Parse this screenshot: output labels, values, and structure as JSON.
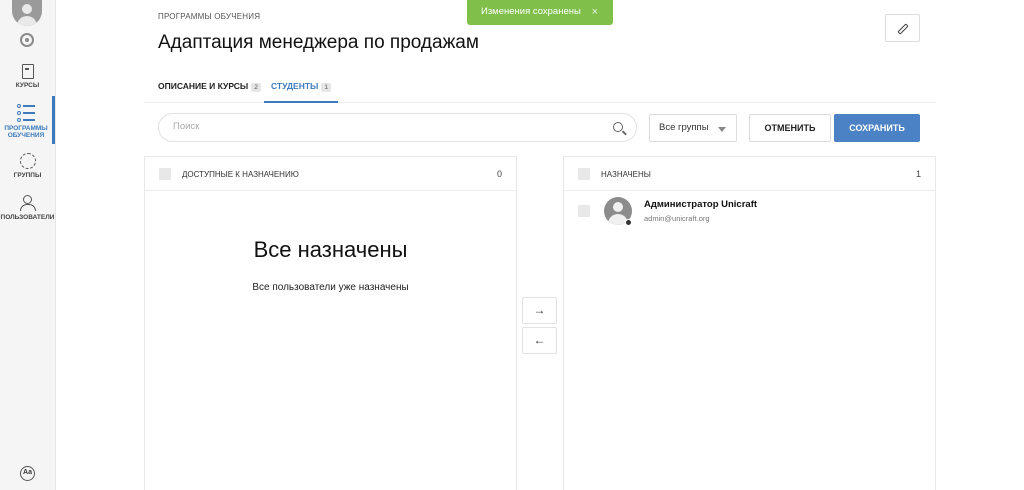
{
  "toast": {
    "text": "Изменения сохранены",
    "close": "×"
  },
  "sidebar": {
    "items": [
      {
        "label": "КУРСЫ",
        "icon": "book-icon"
      },
      {
        "label": "ПРОГРАММЫ ОБУЧЕНИЯ",
        "icon": "list-icon",
        "active": true
      },
      {
        "label": "ГРУППЫ",
        "icon": "groups-icon"
      },
      {
        "label": "ПОЛЬЗОВАТЕЛИ",
        "icon": "users-icon"
      }
    ],
    "lang_label": "Aa"
  },
  "header": {
    "breadcrumb": "ПРОГРАММЫ ОБУЧЕНИЯ",
    "title": "Адаптация менеджера по продажам"
  },
  "tabs": [
    {
      "label": "ОПИСАНИЕ И КУРСЫ",
      "badge": "2"
    },
    {
      "label": "СТУДЕНТЫ",
      "badge": "1",
      "active": true
    }
  ],
  "toolbar": {
    "search_placeholder": "Поиск",
    "group_filter": "Все группы",
    "cancel_label": "ОТМЕНИТЬ",
    "save_label": "СОХРАНИТЬ"
  },
  "available_panel": {
    "title": "ДОСТУПНЫЕ К НАЗНАЧЕНИЮ",
    "count": "0",
    "empty_title": "Все назначены",
    "empty_subtitle": "Все пользователи уже назначены"
  },
  "transfer": {
    "right": "→",
    "left": "←"
  },
  "assigned_panel": {
    "title": "НАЗНАЧЕНЫ",
    "count": "1",
    "users": [
      {
        "name": "Администратор Unicraft",
        "email": "admin@unicraft.org"
      }
    ]
  },
  "colors": {
    "accent": "#3d7bbd",
    "primary_button": "#4a82c5",
    "toast": "#7fbf4a"
  }
}
